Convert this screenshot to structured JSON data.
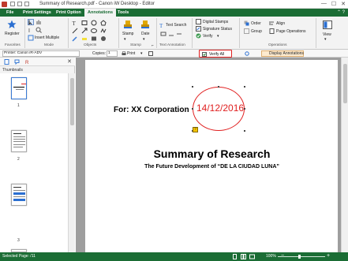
{
  "window": {
    "title": "Summary of Research.pdf - Canon iW Desktop - Editor",
    "controls": {
      "minimize": "—",
      "maximize": "☐",
      "close": "✕"
    }
  },
  "menu_tabs": [
    "File",
    "Print Settings",
    "Print Option",
    "Annotations",
    "Tools"
  ],
  "ribbon": {
    "favorites": {
      "register_label": "Register",
      "group_label": "Favorites"
    },
    "mode": {
      "insert_multiple_label": "Insert Multiple",
      "group_label": "Mode"
    },
    "objects": {
      "group_label": "Objects"
    },
    "stamp": {
      "stamp_label": "Stamp",
      "date_label": "Date",
      "group_label": "Stamp"
    },
    "text_annotation": {
      "text_search_label": "Text Search",
      "group_label": "Text Annotation"
    },
    "signature": {
      "digital_stamps_label": "Digital Stamps",
      "signature_status_label": "Signature Status",
      "verify_label": "Verify"
    },
    "operations": {
      "order_label": "Order",
      "align_label": "Align",
      "group_label": "Group",
      "page_operations_label": "Page Operations",
      "group_title": "Operations"
    },
    "view": {
      "view_label": "View"
    }
  },
  "toolbar": {
    "printer_label": "Printer: Canon iR-ADV",
    "copies_label": "Copies:",
    "copies_value": "1",
    "print_label": "Print",
    "verify_all_label": "Verify All",
    "display_annotations_label": "Display Annotations"
  },
  "left_pane": {
    "thumbnails_label": "Thumbnails",
    "pages": [
      "1",
      "2",
      "3"
    ]
  },
  "document": {
    "for_line": "For: XX Corporation",
    "stamp_date": "14/12/2016",
    "title": "Summary of Research",
    "subtitle": "The Future Development of “DE LA CIUDAD LUNA”"
  },
  "status_bar": {
    "selected_page": "Selected Page: /11",
    "zoom": "100%"
  },
  "colors": {
    "brand_green": "#1b6d35",
    "stamp_red": "#e02020",
    "highlight_red": "#e02020"
  }
}
